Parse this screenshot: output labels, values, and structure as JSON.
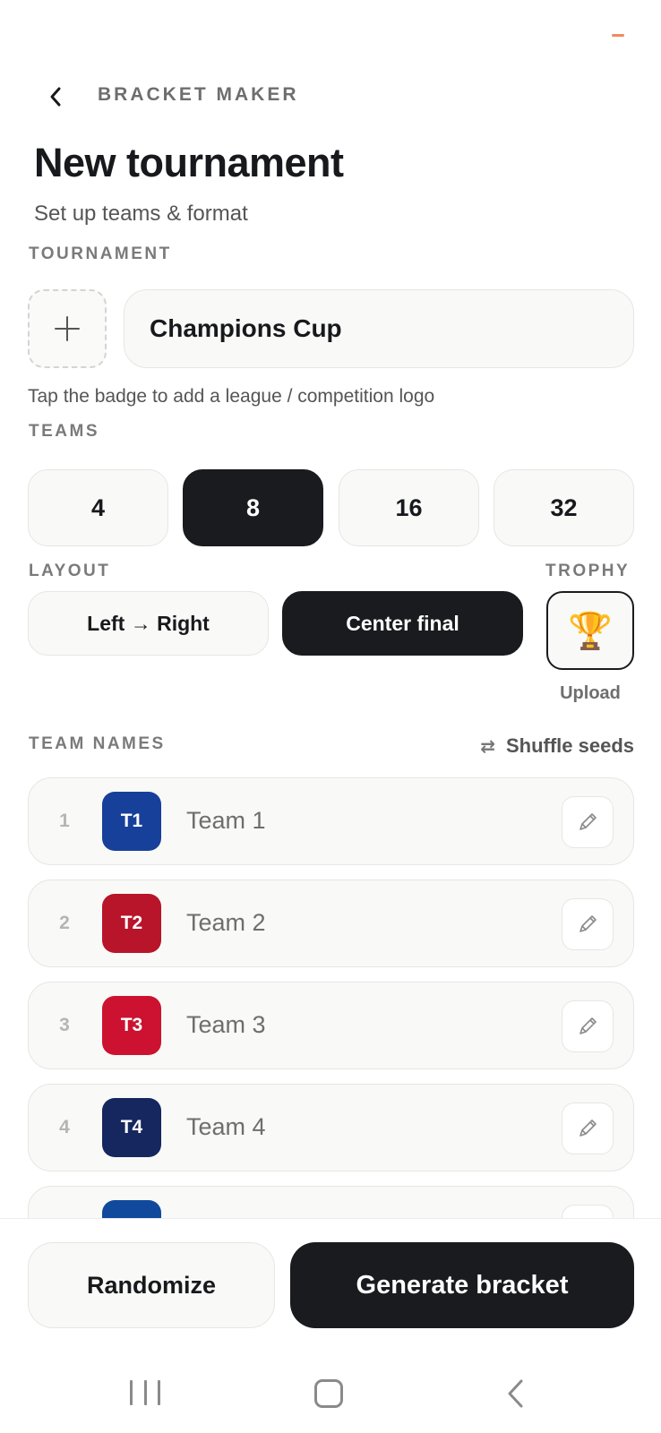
{
  "header": {
    "app_title": "BRACKET MAKER",
    "page_title": "New tournament",
    "page_subtitle": "Set up teams & format"
  },
  "tournament": {
    "section_label": "TOURNAMENT",
    "name_value": "Champions Cup",
    "logo_hint": "Tap the badge to add a league / competition logo"
  },
  "teams_count": {
    "section_label": "TEAMS",
    "options": [
      "4",
      "8",
      "16",
      "32"
    ],
    "selected": "8"
  },
  "layout": {
    "section_label": "LAYOUT",
    "options": [
      "Left → Right",
      "Center final"
    ],
    "selected": "Center final"
  },
  "trophy": {
    "section_label": "TROPHY",
    "icon": "🏆",
    "upload_label": "Upload"
  },
  "team_names": {
    "section_label": "TEAM NAMES",
    "shuffle_icon": "⇄",
    "shuffle_label": "Shuffle seeds",
    "teams": [
      {
        "seed": "1",
        "badge": "T1",
        "name": "Team 1",
        "color": "#17409a"
      },
      {
        "seed": "2",
        "badge": "T2",
        "name": "Team 2",
        "color": "#b8142a"
      },
      {
        "seed": "3",
        "badge": "T3",
        "name": "Team 3",
        "color": "#cc1230"
      },
      {
        "seed": "4",
        "badge": "T4",
        "name": "Team 4",
        "color": "#16265e"
      },
      {
        "seed": "",
        "badge": "",
        "name": "",
        "color": "#114a9c"
      }
    ]
  },
  "actions": {
    "randomize_label": "Randomize",
    "generate_label": "Generate bracket"
  },
  "colors": {
    "accent_dark": "#1a1b1e",
    "surface": "#f9f9f7",
    "status_dash": "#f08a5d"
  }
}
